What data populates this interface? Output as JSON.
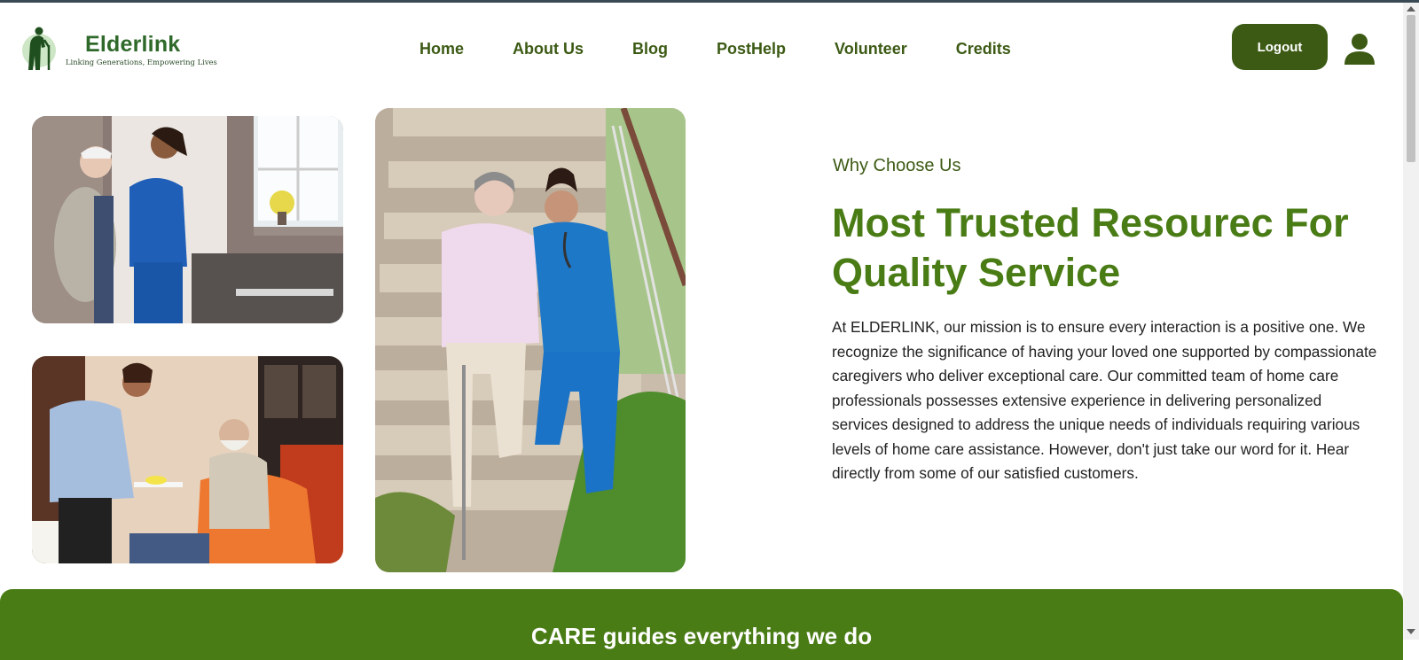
{
  "brand": {
    "name": "Elderlink",
    "tagline": "Linking Generations, Empowering Lives"
  },
  "nav": {
    "items": [
      "Home",
      "About Us",
      "Blog",
      "PostHelp",
      "Volunteer",
      "Credits"
    ]
  },
  "header": {
    "logout_label": "Logout"
  },
  "section": {
    "eyebrow": "Why Choose Us",
    "headline": "Most Trusted Resourec For Quality Service",
    "paragraph": "At ELDERLINK, our mission is to ensure every interaction is a positive one. We recognize the significance of having your loved one supported by compassionate caregivers who deliver exceptional care. Our committed team of home care professionals possesses extensive experience in delivering personalized services designed to address the unique needs of individuals requiring various levels of home care assistance. However, don't just take our word for it. Hear directly from some of our satisfied customers."
  },
  "band": {
    "title": "CARE guides everything we do"
  },
  "colors": {
    "primary_dark": "#3c5a14",
    "primary": "#4a7c16",
    "brand_text": "#2f6a2a"
  }
}
